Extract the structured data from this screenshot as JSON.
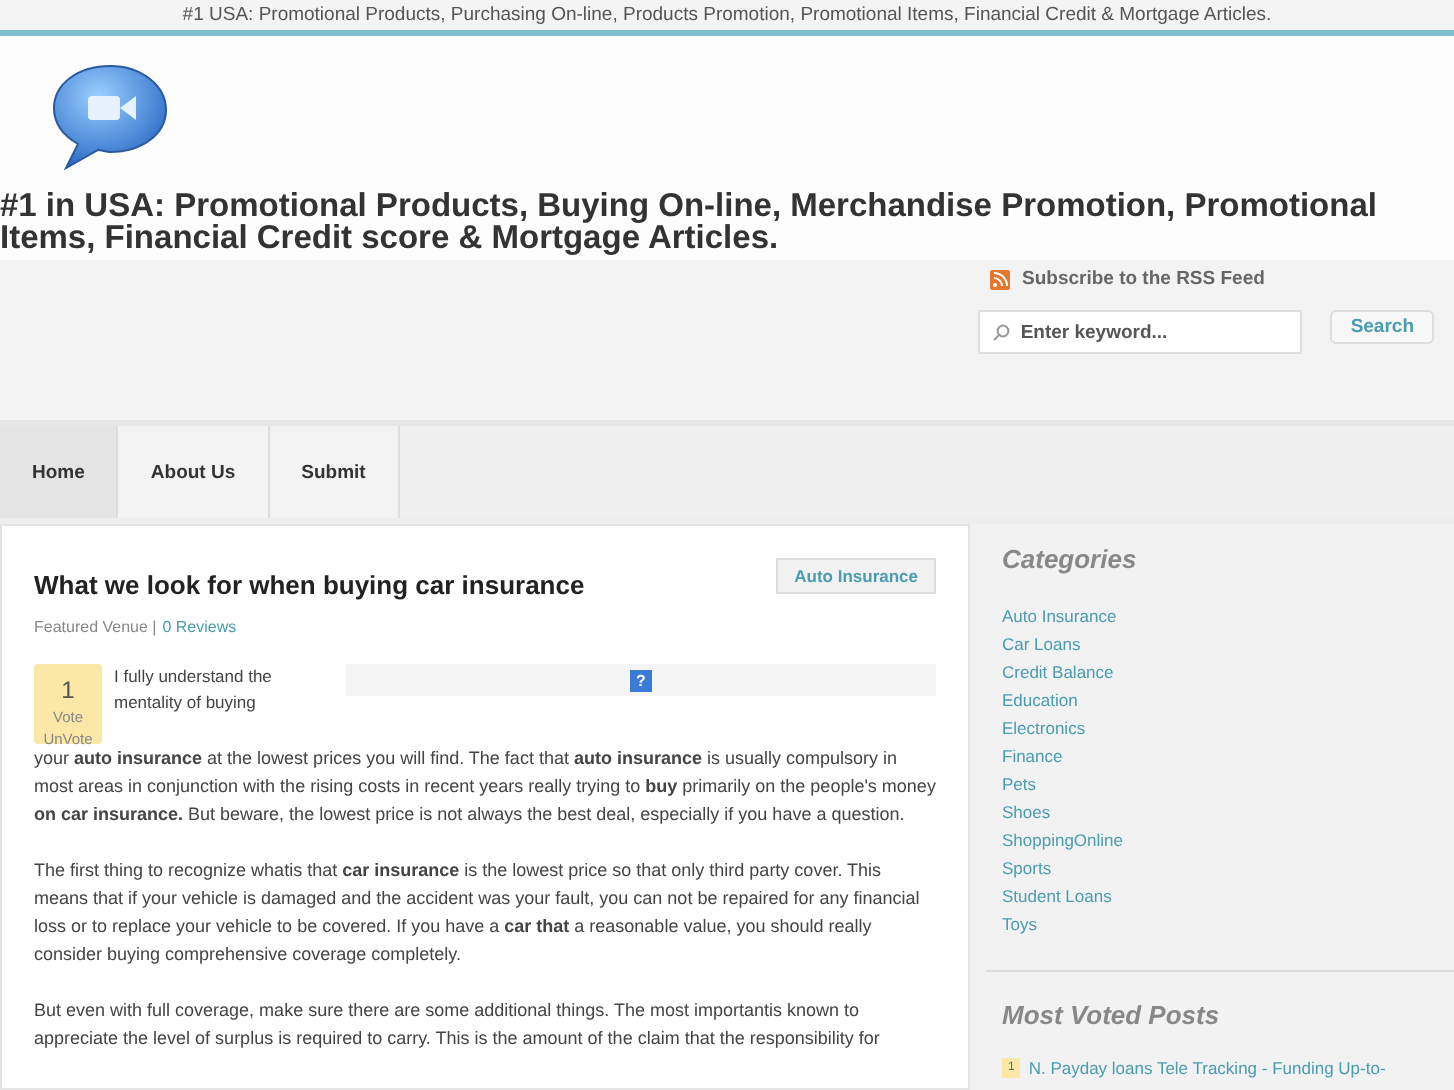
{
  "top_bar": {
    "text": "#1 USA: Promotional Products, Purchasing On-line, Products Promotion, Promotional Items, Financial Credit & Mortgage Articles."
  },
  "header": {
    "site_title": "#1 in USA: Promotional Products, Buying On-line, Merchandise Promotion, Promotional Items, Financial Credit score & Mortgage Articles."
  },
  "rss": {
    "label": "Subscribe to the RSS Feed"
  },
  "search": {
    "placeholder": "Enter keyword...",
    "button": "Search"
  },
  "nav": [
    {
      "label": "Home",
      "selected": true
    },
    {
      "label": "About Us",
      "selected": false
    },
    {
      "label": "Submit",
      "selected": false
    }
  ],
  "post": {
    "title": "What we look for when buying car insurance",
    "category": "Auto Insurance",
    "meta": "Featured Venue |",
    "reviews": "0 Reviews",
    "vote": {
      "count": "1",
      "vote": "Vote",
      "unvote": "UnVote"
    },
    "ad_icon": "?",
    "intro": "I fully understand the mentality of buying",
    "paragraphs": [
      "your **auto insurance** at the lowest prices you will find. The fact that **auto insurance** is usually compulsory in most areas in conjunction with the rising costs in recent years really trying to **buy** primarily on the people's money **on car insurance.** But beware, the lowest price is not always the best deal, especially if you have a question.",
      "The first thing to recognize whatis that **car insurance** is the lowest price so that only third party cover. This means that if your vehicle is damaged and the accident was your fault, you can not be repaired for any financial loss or to replace your vehicle to be covered. If you have a **car that** a reasonable value, you should really consider buying comprehensive coverage completely.",
      "But even with full coverage, make sure there are some additional things. The most importantis known to appreciate the level of surplus is required to carry. This is the amount of the claim that the responsibility for"
    ]
  },
  "sidebar": {
    "categories_title": "Categories",
    "categories": [
      "Auto Insurance",
      "Car Loans",
      "Credit Balance",
      "Education",
      "Electronics",
      "Finance",
      "Pets",
      "Shoes",
      "ShoppingOnline",
      "Sports",
      "Student Loans",
      "Toys"
    ],
    "most_voted_title": "Most Voted Posts",
    "most_voted": [
      {
        "count": "1",
        "title": "N. Payday loans Tele Tracking - Funding Up-to-"
      }
    ]
  }
}
